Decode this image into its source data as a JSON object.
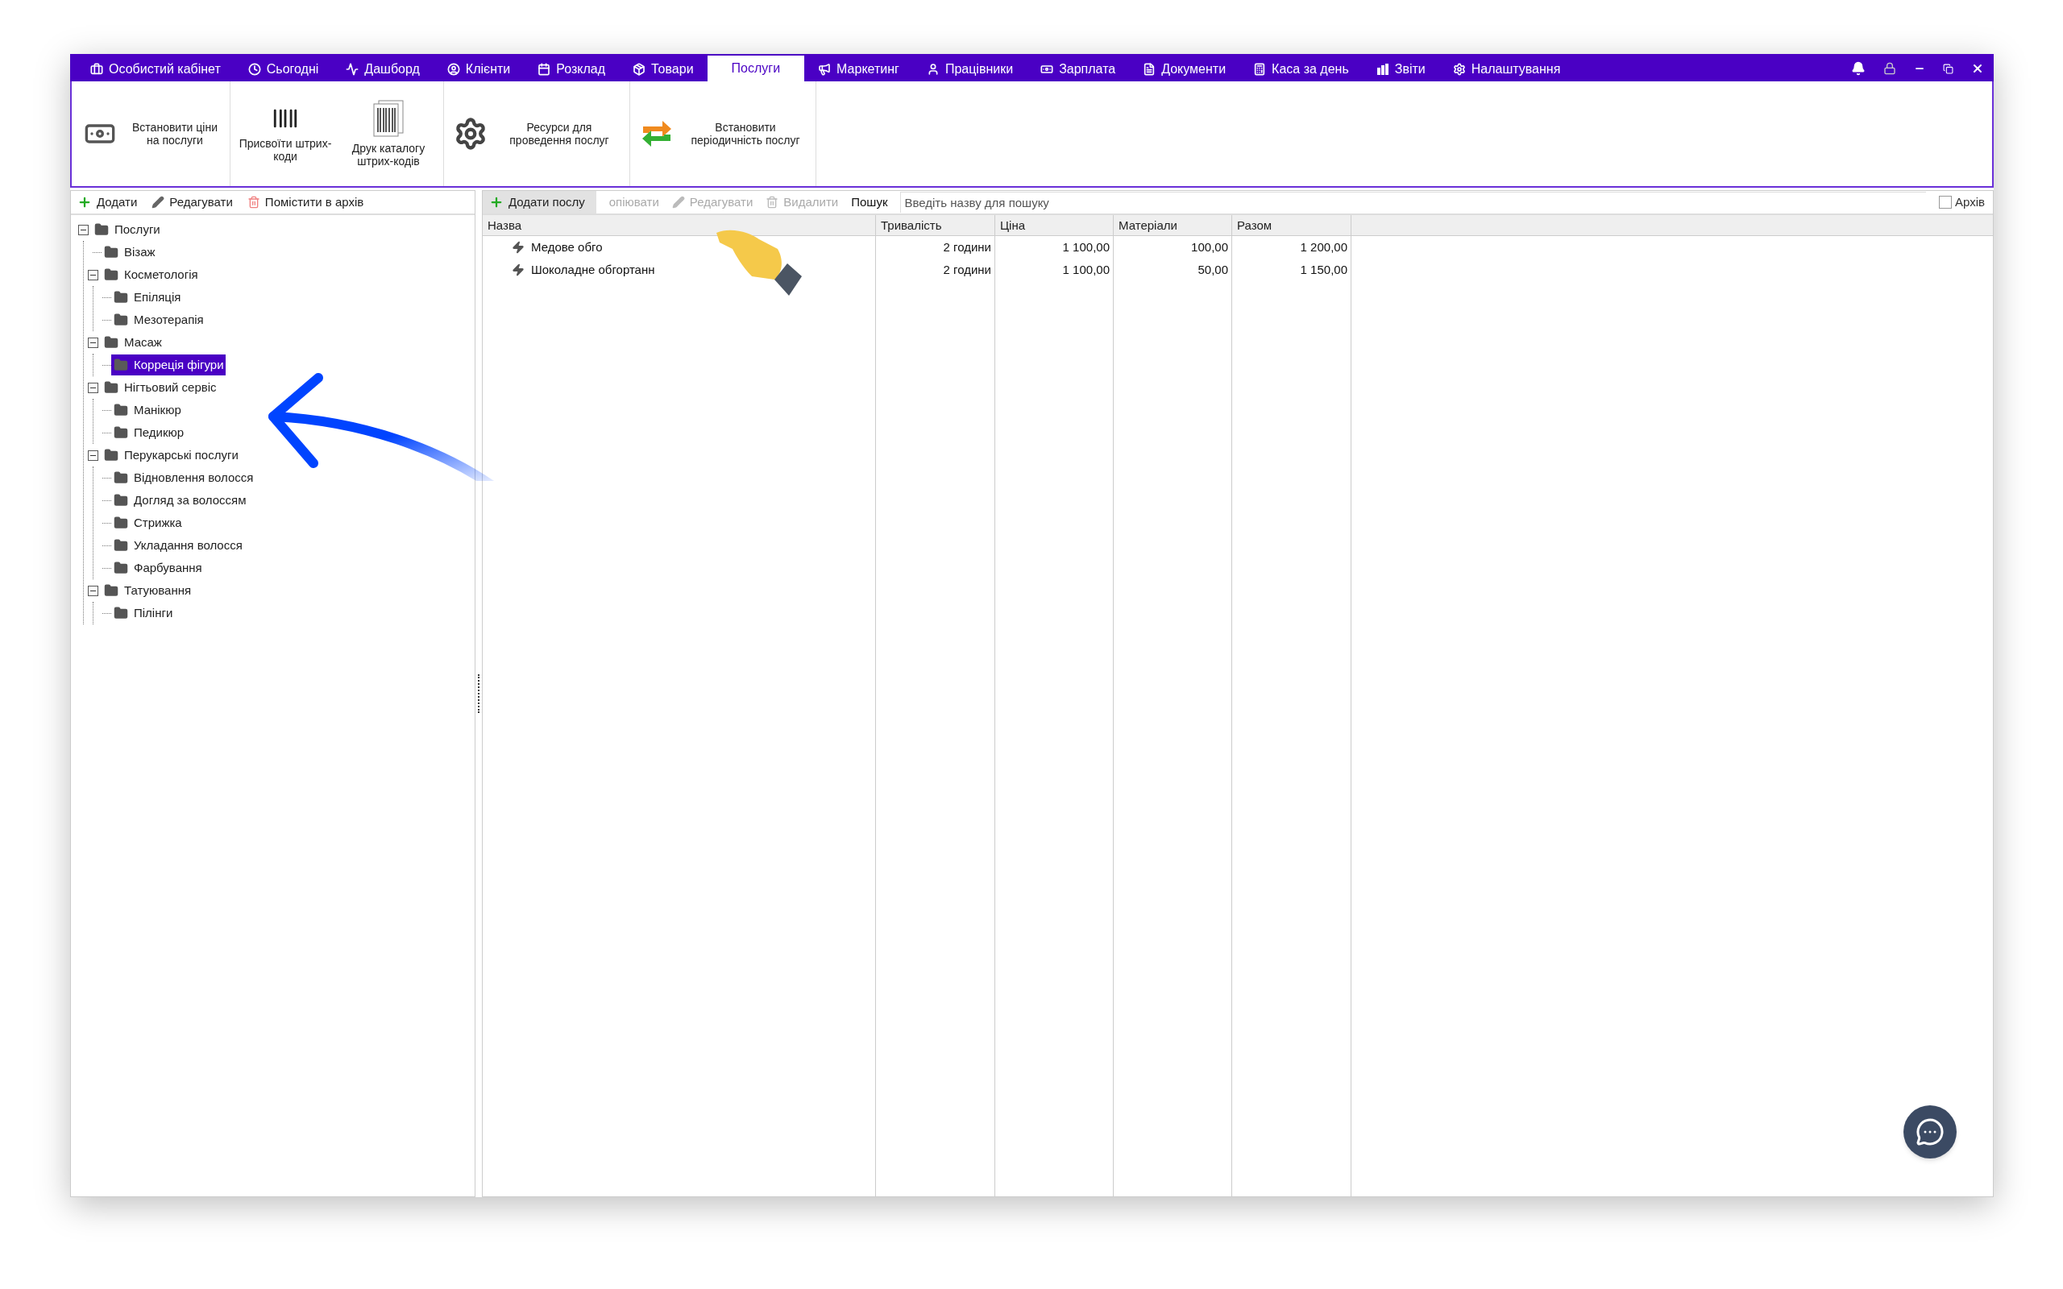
{
  "menu": [
    {
      "label": "Особистий кабінет",
      "kind": "briefcase",
      "selected": false
    },
    {
      "label": "Сьогодні",
      "kind": "clock",
      "selected": false
    },
    {
      "label": "Дашборд",
      "kind": "pulse",
      "selected": false
    },
    {
      "label": "Клієнти",
      "kind": "person-circle",
      "selected": false
    },
    {
      "label": "Розклад",
      "kind": "calendar",
      "selected": false
    },
    {
      "label": "Товари",
      "kind": "box",
      "selected": false
    },
    {
      "label": "Послуги",
      "kind": "plain",
      "selected": true
    },
    {
      "label": "Маркетинг",
      "kind": "megaphone",
      "selected": false
    },
    {
      "label": "Працівники",
      "kind": "person",
      "selected": false
    },
    {
      "label": "Зарплата",
      "kind": "money",
      "selected": false
    },
    {
      "label": "Документи",
      "kind": "file",
      "selected": false
    },
    {
      "label": "Каса за день",
      "kind": "calculator",
      "selected": false
    },
    {
      "label": "Звіти",
      "kind": "bars",
      "selected": false
    },
    {
      "label": "Налаштування",
      "kind": "gear",
      "selected": false
    }
  ],
  "ribbon": [
    [
      {
        "label": "Встановити ціни на послуги",
        "kind": "money"
      }
    ],
    [
      {
        "label": "Присвоїти штрих-коди",
        "kind": "barcode"
      },
      {
        "label": "Друк каталогу штрих-кодів",
        "kind": "catalog"
      }
    ],
    [
      {
        "label": "Ресурси для проведення послуг",
        "kind": "gear"
      }
    ],
    [
      {
        "label": "Встановити періодичність послуг",
        "kind": "cycle"
      }
    ]
  ],
  "left_toolbar": [
    {
      "label": "Додати",
      "kind": "plus"
    },
    {
      "label": "Редагувати",
      "kind": "pencil"
    },
    {
      "label": "Помістити в архів",
      "kind": "trash"
    }
  ],
  "tree": [
    {
      "label": "Послуги",
      "selected": false,
      "expanded": true,
      "children": [
        {
          "label": "Візаж",
          "selected": false
        },
        {
          "label": "Косметологія",
          "selected": false,
          "expanded": true,
          "children": [
            {
              "label": "Епіляція",
              "selected": false
            },
            {
              "label": "Мезотерапія",
              "selected": false
            }
          ]
        },
        {
          "label": "Масаж",
          "selected": false,
          "expanded": true,
          "children": [
            {
              "label": "Корреція фігури",
              "selected": true
            }
          ]
        },
        {
          "label": "Нігтьовий сервіс",
          "selected": false,
          "expanded": true,
          "children": [
            {
              "label": "Манікюр",
              "selected": false
            },
            {
              "label": "Педикюр",
              "selected": false
            }
          ]
        },
        {
          "label": "Перукарські послуги",
          "selected": false,
          "expanded": true,
          "children": [
            {
              "label": "Відновлення волосся",
              "selected": false
            },
            {
              "label": "Догляд за волоссям",
              "selected": false
            },
            {
              "label": "Стрижка",
              "selected": false
            },
            {
              "label": "Укладання волосся",
              "selected": false
            },
            {
              "label": "Фарбування",
              "selected": false
            }
          ]
        },
        {
          "label": "Татуювання",
          "selected": false,
          "expanded": true,
          "children": [
            {
              "label": "Пілінги",
              "selected": false
            }
          ]
        }
      ]
    }
  ],
  "table_toolbar": {
    "buttons": [
      {
        "label": "Додати послу",
        "kind": "plus",
        "disabled": false
      },
      {
        "label": "опіювати",
        "kind": "plain",
        "disabled": true
      },
      {
        "label": "Редагувати",
        "kind": "pencil",
        "disabled": true
      },
      {
        "label": "Видалити",
        "kind": "trash",
        "disabled": true
      }
    ],
    "search_label": "Пошук",
    "search": {
      "placeholder": "Введіть назву для пошуку"
    },
    "archive": {
      "label": "Архів",
      "checked": false
    }
  },
  "table": {
    "columns": [
      "Назва",
      "Тривалість",
      "Ціна",
      "Матеріали",
      "Разом"
    ],
    "rows": [
      [
        "Медове обго",
        "2 години",
        "1 100,00",
        "100,00",
        "1 200,00"
      ],
      [
        "Шоколадне обгортанн",
        "2 години",
        "1 100,00",
        "50,00",
        "1 150,00"
      ]
    ]
  }
}
